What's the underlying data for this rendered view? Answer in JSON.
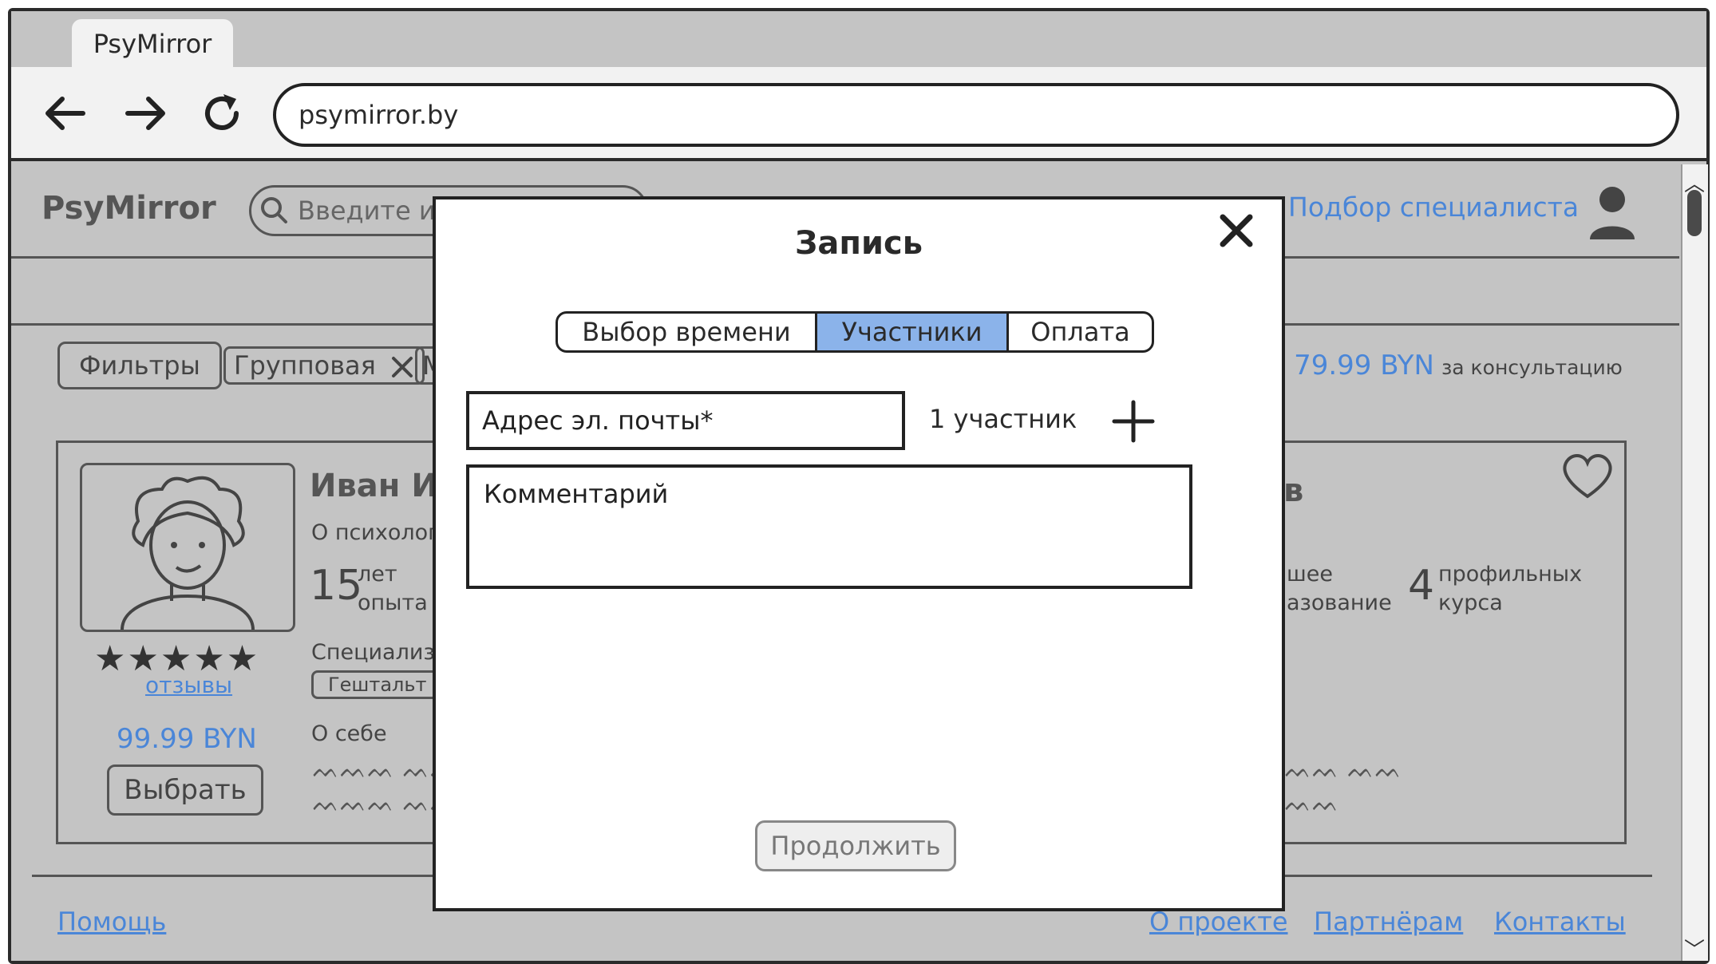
{
  "browser": {
    "tab_title": "PsyMirror",
    "url": "psymirror.by",
    "back_icon": "arrow-left-icon",
    "forward_icon": "arrow-right-icon",
    "reload_icon": "reload-icon"
  },
  "header": {
    "logo": "PsyMirror",
    "search_placeholder": "Введите имя",
    "link": "Подбор специалиста",
    "avatar_icon": "user-icon"
  },
  "filters": {
    "filters_button": "Фильтры",
    "chips": [
      "Групповая",
      "М"
    ],
    "price_range": "- 79.99 BYN",
    "price_suffix": "за консультацию"
  },
  "card": {
    "name": "Иван Ив",
    "about_psychologist": "О психолог",
    "years": "15",
    "years_label_1": "лет",
    "years_label_2": "опыта",
    "specialization": "Специализ",
    "tag": "Гештальт",
    "about_self": "О себе",
    "squiggle_1": "ᨓᨓᨓ ᨓᨓ",
    "squiggle_2": "ᨓᨓᨓ ᨓᨓ",
    "reviews_link": "отзывы",
    "price": "99.99 BYN",
    "choose_button": "Выбрать",
    "rating": 5,
    "right_name_tail": "в",
    "edu_1": "шее",
    "edu_2": "азование",
    "courses": "4",
    "courses_label_1": "профильных",
    "courses_label_2": "курса",
    "right_squiggle_1": "ᨓᨓ ᨓᨓ",
    "right_squiggle_2": "ᨓᨓ"
  },
  "footer": {
    "help": "Помощь",
    "about": "О проекте",
    "partners": "Партнёрам",
    "contacts": "Контакты"
  },
  "modal": {
    "title": "Запись",
    "steps": [
      "Выбор времени",
      "Участники",
      "Оплата"
    ],
    "active_step": 1,
    "email_placeholder": "Адрес эл. почты*",
    "participants": "1 участник",
    "comment_placeholder": "Комментарий",
    "continue_button": "Продолжить"
  },
  "colors": {
    "accent": "#4a86d8",
    "active_step": "#8bb3ea"
  }
}
